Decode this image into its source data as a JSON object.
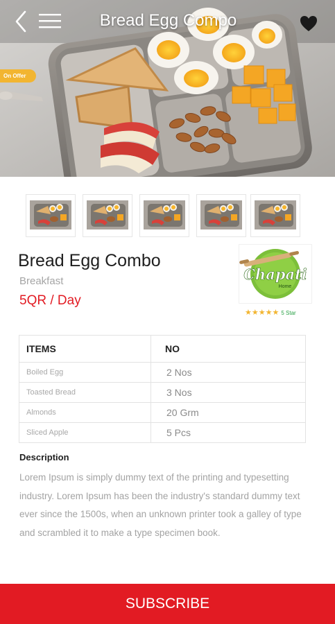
{
  "header": {
    "title": "Bread Egg Compo"
  },
  "hero": {
    "offer_badge": "On Offer"
  },
  "gallery": {
    "thumbnail_count": 5
  },
  "product": {
    "name": "Bread Egg Combo",
    "category": "Breakfast",
    "price": "5QR / Day"
  },
  "vendor": {
    "logo_text": "Chapati",
    "logo_subtext": "Home",
    "rating_value": 5,
    "rating_max": 5,
    "rating_label": "5 Star"
  },
  "items_table": {
    "headers": [
      "ITEMS",
      "NO"
    ],
    "rows": [
      {
        "item": "Boiled Egg",
        "qty": "2 Nos"
      },
      {
        "item": "Toasted Bread",
        "qty": "3 Nos"
      },
      {
        "item": "Almonds",
        "qty": "20 Grm"
      },
      {
        "item": "Sliced Apple",
        "qty": "5 Pcs"
      }
    ]
  },
  "description": {
    "title": "Description",
    "text": "Lorem Ipsum is simply dummy text of the printing and typesetting industry. Lorem Ipsum has been the industry's standard dummy text ever since the 1500s, when an unknown printer took a galley of type and scrambled it to make a type specimen book."
  },
  "subscribe": {
    "label": "SUBSCRIBE"
  },
  "colors": {
    "accent_red": "#e21b23",
    "offer_yellow": "#f2b531",
    "star_yellow": "#f2b531",
    "logo_green": "#7cbf3a"
  }
}
